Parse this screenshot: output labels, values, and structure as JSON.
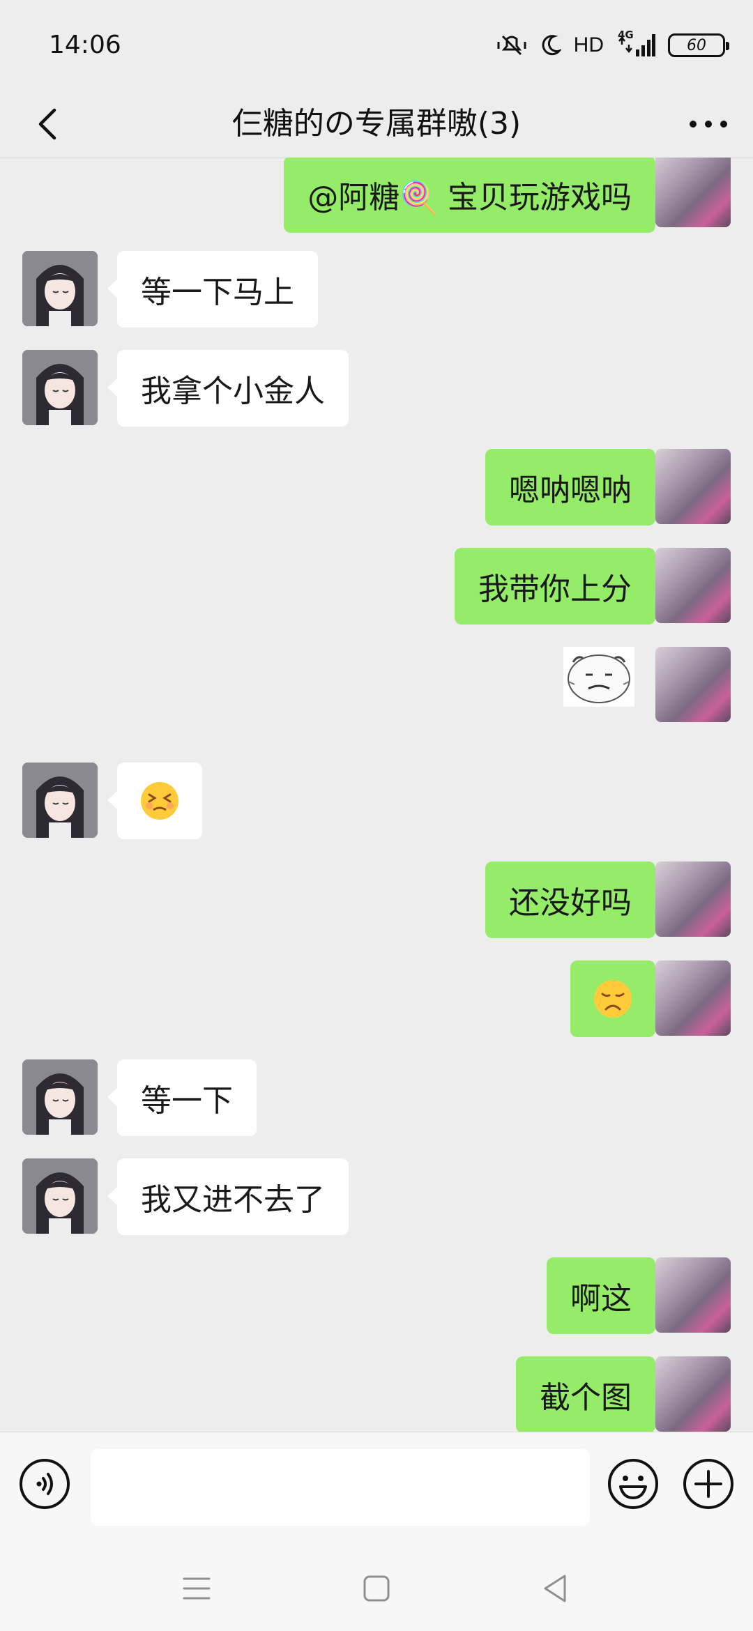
{
  "status_bar": {
    "time": "14:06",
    "network_label": "HD",
    "signal_label": "4G",
    "battery_level": "60",
    "icons": [
      "mute-vibrate-icon",
      "moon-icon",
      "signal-icon",
      "battery-icon"
    ]
  },
  "header": {
    "title": "仨糖的の专属群嗷(3)",
    "back_icon": "chevron-left-icon",
    "more_icon": "more-horizontal-icon"
  },
  "messages": [
    {
      "side": "out",
      "type": "text",
      "text": "@阿糖🍭  宝贝玩游戏吗"
    },
    {
      "side": "in",
      "type": "text",
      "text": "等一下马上"
    },
    {
      "side": "in",
      "type": "text",
      "text": "我拿个小金人"
    },
    {
      "side": "out",
      "type": "text",
      "text": "嗯呐嗯呐"
    },
    {
      "side": "out",
      "type": "text",
      "text": "我带你上分"
    },
    {
      "side": "out",
      "type": "sticker",
      "sticker": "sketch-face-sticker"
    },
    {
      "side": "in",
      "type": "emoji",
      "emoji": "😣"
    },
    {
      "side": "out",
      "type": "text",
      "text": "还没好吗"
    },
    {
      "side": "out",
      "type": "emoji",
      "emoji": "😞"
    },
    {
      "side": "in",
      "type": "text",
      "text": "等一下"
    },
    {
      "side": "in",
      "type": "text",
      "text": "我又进不去了"
    },
    {
      "side": "out",
      "type": "text",
      "text": "啊这"
    },
    {
      "side": "out",
      "type": "text",
      "text": "截个图"
    }
  ],
  "input_bar": {
    "voice_icon": "voice-icon",
    "input_value": "",
    "emoji_icon": "smiley-icon",
    "plus_icon": "plus-icon"
  },
  "system_nav": {
    "icons": [
      "menu-icon",
      "home-icon",
      "back-triangle-icon"
    ]
  },
  "colors": {
    "background": "#EDEDED",
    "out_bubble": "#95EC69",
    "in_bubble": "#FFFFFF"
  }
}
